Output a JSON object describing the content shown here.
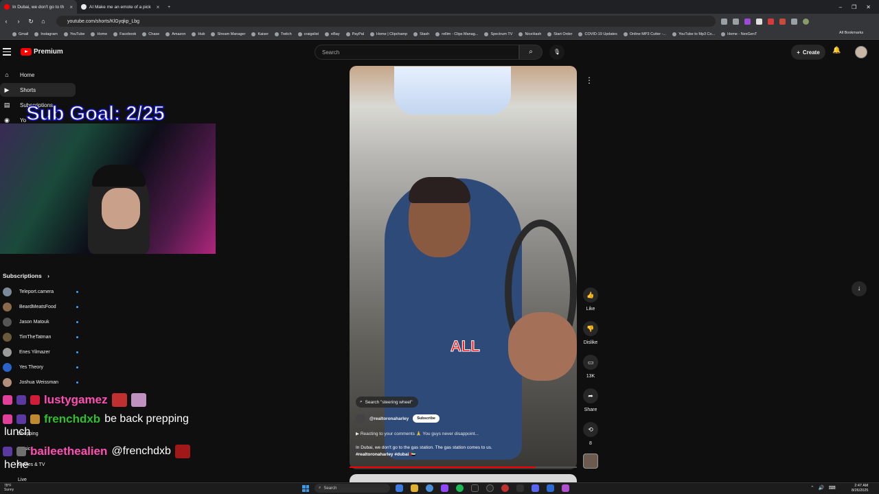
{
  "browser": {
    "tabs": [
      {
        "title": "In Dubai, we don't go to th",
        "active": true
      },
      {
        "title": "AI Make me an emote of a pick",
        "active": false
      }
    ],
    "new_tab": "+",
    "url": "youtube.com/shorts/KlGyqkp_Lbg",
    "all_bookmarks": "All Bookmarks",
    "bookmarks": [
      "Gmail",
      "Instagram",
      "YouTube",
      "Home",
      "Facebook",
      "Chase",
      "Amazon",
      "Hub",
      "Stream Manager",
      "Kaiser",
      "Twitch",
      "craigslist",
      "eBay",
      "PayPal",
      "Home | Clipchamp",
      "Stash",
      "rellim - Clips Manag...",
      "Spectrum TV",
      "NiceHash",
      "Start Order",
      "COVID-19 Updates",
      "Online MP3 Cutter -...",
      "YouTube to Mp3 Co...",
      "Home - NexGenT"
    ]
  },
  "youtube": {
    "logo_text": "Premium",
    "search_placeholder": "Search",
    "create_label": "Create",
    "nav": [
      {
        "label": "Home",
        "icon": "home-icon",
        "glyph": "⌂"
      },
      {
        "label": "Shorts",
        "icon": "shorts-icon",
        "glyph": "▶"
      },
      {
        "label": "Subscriptions",
        "icon": "subscriptions-icon",
        "glyph": "▤"
      },
      {
        "label": "Yo",
        "icon": "you-icon",
        "glyph": "◉"
      }
    ],
    "subscriptions_heading": "Subscriptions",
    "subscriptions": [
      {
        "name": "Teleport.camera",
        "color": "#7a8a9a"
      },
      {
        "name": "BeardMeatsFood",
        "color": "#8a6a4a"
      },
      {
        "name": "Jason Matouk",
        "color": "#555555"
      },
      {
        "name": "TimTheTatman",
        "color": "#6a5a3a"
      },
      {
        "name": "Enes Yilmazer",
        "color": "#9a9a9a"
      },
      {
        "name": "Yes Theory",
        "color": "#2a62c9"
      },
      {
        "name": "Joshua Weissman",
        "color": "#b0907a"
      }
    ],
    "sidebar_partial": [
      "Shopping",
      "Music",
      "Movies & TV",
      "Live"
    ]
  },
  "stream_overlay": {
    "sub_goal": "Sub Goal: 2/25"
  },
  "short": {
    "caption_word": "ALL",
    "search_suggestion": "Search \"steering wheel\"",
    "channel": "@realtoronaharley",
    "subscribe_label": "Subscribe",
    "reacting": "Reacting to your comments 🙏 You guys never disappoint...",
    "description": "In Dubai, we don't go to the gas station. The gas station comes to us.",
    "hashtags": "#realtoronaharley #dubai 🇦🇪",
    "progress_fraction": 0.82,
    "actions": {
      "like": "Like",
      "dislike": "Dislike",
      "comments": "13K",
      "share": "Share",
      "remix": "8"
    }
  },
  "chat": [
    {
      "name": "lustygamez",
      "name_color": "#ff4fb4",
      "message": ""
    },
    {
      "name": "frenchdxb",
      "name_color": "#2fbf2f",
      "message": "be back prepping"
    },
    {
      "name": "baileethealien",
      "name_color": "#ff4fb4",
      "message": "@frenchdxb"
    }
  ],
  "chat_wrap": [
    "lunch",
    "hehe"
  ],
  "taskbar": {
    "weather_temp": "78°F",
    "weather_desc": "Sunny",
    "search_label": "Search",
    "time": "2:47 AM",
    "date": "8/26/2025"
  }
}
